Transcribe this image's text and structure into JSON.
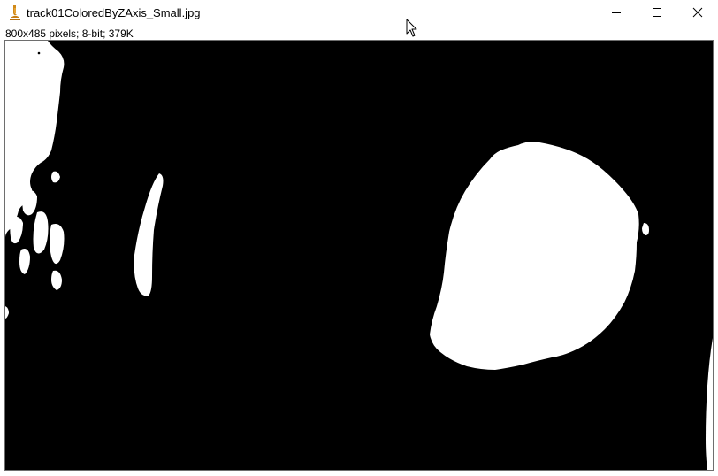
{
  "window": {
    "title": "track01ColoredByZAxis_Small.jpg",
    "app_icon": "imagej-microscope-icon",
    "controls": {
      "minimize": "minimize-icon",
      "maximize": "maximize-icon",
      "close": "close-icon"
    }
  },
  "image_info": {
    "text": "800x485 pixels; 8-bit; 379K"
  },
  "image": {
    "description_colors": {
      "background": "#000000",
      "foreground": "#ffffff"
    }
  }
}
